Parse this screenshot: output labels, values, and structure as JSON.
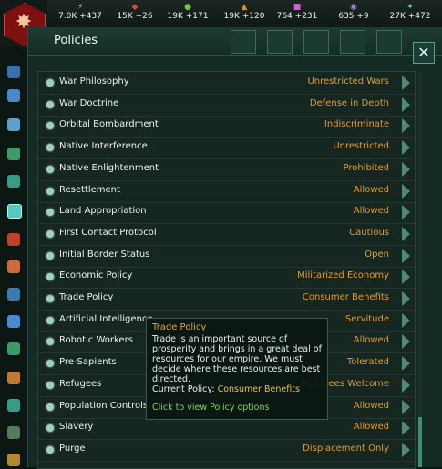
{
  "resources": [
    {
      "icon": "energy-icon",
      "symbol": "⚡",
      "color": "#e7c23a",
      "value": "7.0K +437"
    },
    {
      "icon": "minerals-icon",
      "symbol": "◆",
      "color": "#d84545",
      "value": "15K +26"
    },
    {
      "icon": "food-icon",
      "symbol": "●",
      "color": "#78c040",
      "value": "19K +171"
    },
    {
      "icon": "consumer-goods-icon",
      "symbol": "▲",
      "color": "#d88a3a",
      "value": "19K +120"
    },
    {
      "icon": "alloys-icon",
      "symbol": "■",
      "color": "#c866c8",
      "value": "764 +231"
    },
    {
      "icon": "influence-icon",
      "symbol": "◉",
      "color": "#a87ad8",
      "value": "635 +9"
    },
    {
      "icon": "unity-icon",
      "symbol": "✦",
      "color": "#60c8b0",
      "value": "27K +472"
    }
  ],
  "panel": {
    "title": "Policies",
    "close": "✕"
  },
  "policies": [
    {
      "name": "War Philosophy",
      "value": "Unrestricted Wars"
    },
    {
      "name": "War Doctrine",
      "value": "Defense in Depth"
    },
    {
      "name": "Orbital Bombardment",
      "value": "Indiscriminate"
    },
    {
      "name": "Native Interference",
      "value": "Unrestricted"
    },
    {
      "name": "Native Enlightenment",
      "value": "Prohibited"
    },
    {
      "name": "Resettlement",
      "value": "Allowed"
    },
    {
      "name": "Land Appropriation",
      "value": "Allowed"
    },
    {
      "name": "First Contact Protocol",
      "value": "Cautious"
    },
    {
      "name": "Initial Border Status",
      "value": "Open"
    },
    {
      "name": "Economic Policy",
      "value": "Militarized Economy"
    },
    {
      "name": "Trade Policy",
      "value": "Consumer Benefits"
    },
    {
      "name": "Artificial Intelligence",
      "value": "Servitude"
    },
    {
      "name": "Robotic Workers",
      "value": "Allowed"
    },
    {
      "name": "Pre-Sapients",
      "value": "Tolerated"
    },
    {
      "name": "Refugees",
      "value": "Refugees Welcome"
    },
    {
      "name": "Population Controls",
      "value": "Allowed"
    },
    {
      "name": "Slavery",
      "value": "Allowed"
    },
    {
      "name": "Purge",
      "value": "Displacement Only"
    }
  ],
  "tooltip": {
    "title": "Trade Policy",
    "body": "Trade is an important source of prosperity and brings in a great deal of resources for our empire. We must decide where these resources are best directed.",
    "current_label": "Current Policy: ",
    "current_value": "Consumer Benefits",
    "click_hint": "Click to view Policy options"
  }
}
